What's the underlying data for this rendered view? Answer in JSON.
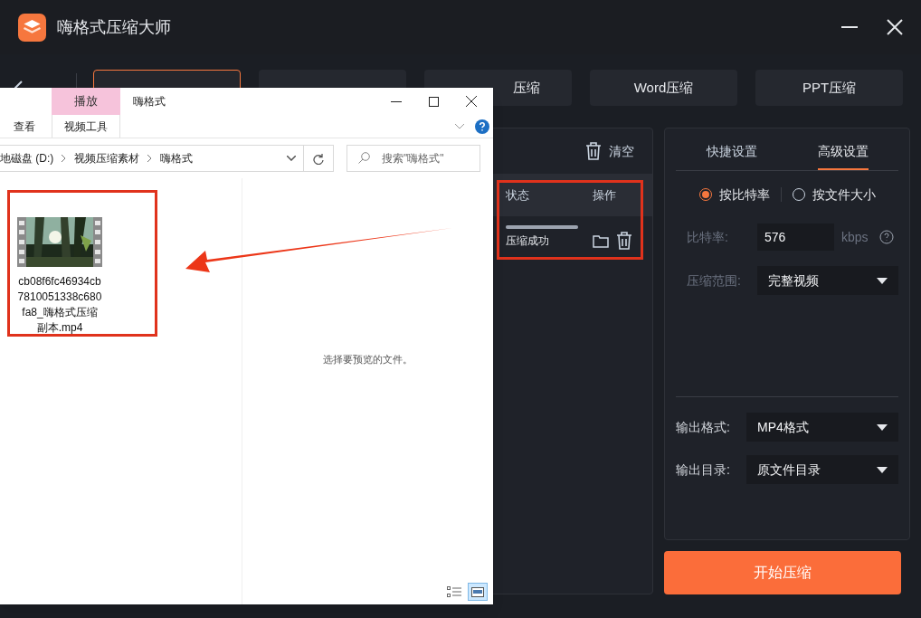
{
  "app": {
    "title": "嗨格式压缩大师",
    "tabs": [
      {
        "selected": true
      },
      {
        "selected": false
      },
      {
        "label": "压缩",
        "selected": false
      },
      {
        "label": "Word压缩",
        "selected": false
      },
      {
        "label": "PPT压缩",
        "selected": false
      }
    ],
    "file_list": {
      "clear_label": "清空",
      "columns": [
        "状态",
        "操作"
      ],
      "rows": [
        {
          "level": 1,
          "status": "压缩成功"
        }
      ]
    },
    "settings": {
      "tabs": [
        {
          "label": "快捷设置",
          "selected": false
        },
        {
          "label": "高级设置",
          "selected": true
        }
      ],
      "modes": [
        {
          "label": "按比特率",
          "selected": true
        },
        {
          "label": "按文件大小",
          "selected": false
        }
      ],
      "bitrate": {
        "label": "比特率:",
        "value": "576",
        "unit": "kbps"
      },
      "range": {
        "label": "压缩范围:",
        "value": "完整视频"
      },
      "output_format": {
        "label": "输出格式:",
        "value": "MP4格式"
      },
      "output_dir": {
        "label": "输出目录:",
        "value": "原文件目录"
      }
    },
    "start_button": "开始压缩"
  },
  "explorer": {
    "title": "嗨格式",
    "contextual_tab": "播放",
    "ribbon_tabs": [
      {
        "label": "查看"
      },
      {
        "label": "视频工具"
      }
    ],
    "breadcrumb": [
      "地磁盘 (D:)",
      "视频压缩素材",
      "嗨格式"
    ],
    "search": {
      "placeholder": "搜索\"嗨格式\""
    },
    "files": [
      {
        "name": "cb08f6fc46934cb7810051338c680fa8_嗨格式压缩副本.mp4"
      }
    ],
    "preview_message": "选择要预览的文件。",
    "view_buttons": [
      {
        "selected": false
      },
      {
        "selected": true
      }
    ]
  }
}
